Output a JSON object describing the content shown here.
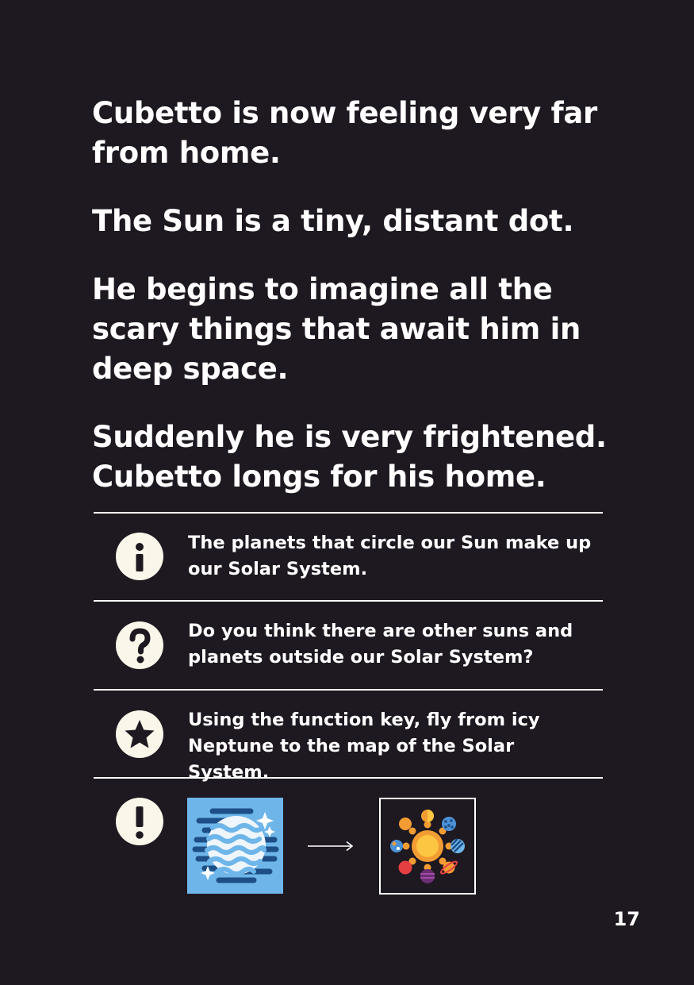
{
  "story": {
    "p1": "Cubetto is now feeling very far from home.",
    "p2": "The Sun is a tiny, distant dot.",
    "p3": "He begins to imagine all the scary things that await him in deep space.",
    "p4_line1": "Suddenly he is very frightened.",
    "p4_line2": "Cubetto longs for his home."
  },
  "info": {
    "fact": "The planets that circle our Sun make up our Solar System.",
    "question": "Do you think there are other suns and planets outside our Solar System?",
    "activity": "Using the function key, fly from icy Neptune to the map of the Solar System."
  },
  "icons": {
    "info": "info-icon",
    "question": "question-icon",
    "star": "star-icon",
    "exclamation": "exclamation-icon",
    "neptune": "neptune-tile",
    "arrow": "right-arrow",
    "solar_system": "solar-system-map-tile"
  },
  "colors": {
    "background": "#1e1820",
    "badge": "#fbf6ea",
    "neptune_tile": "#6eb6ea",
    "sun": "#fcc542"
  },
  "page_number": "17"
}
